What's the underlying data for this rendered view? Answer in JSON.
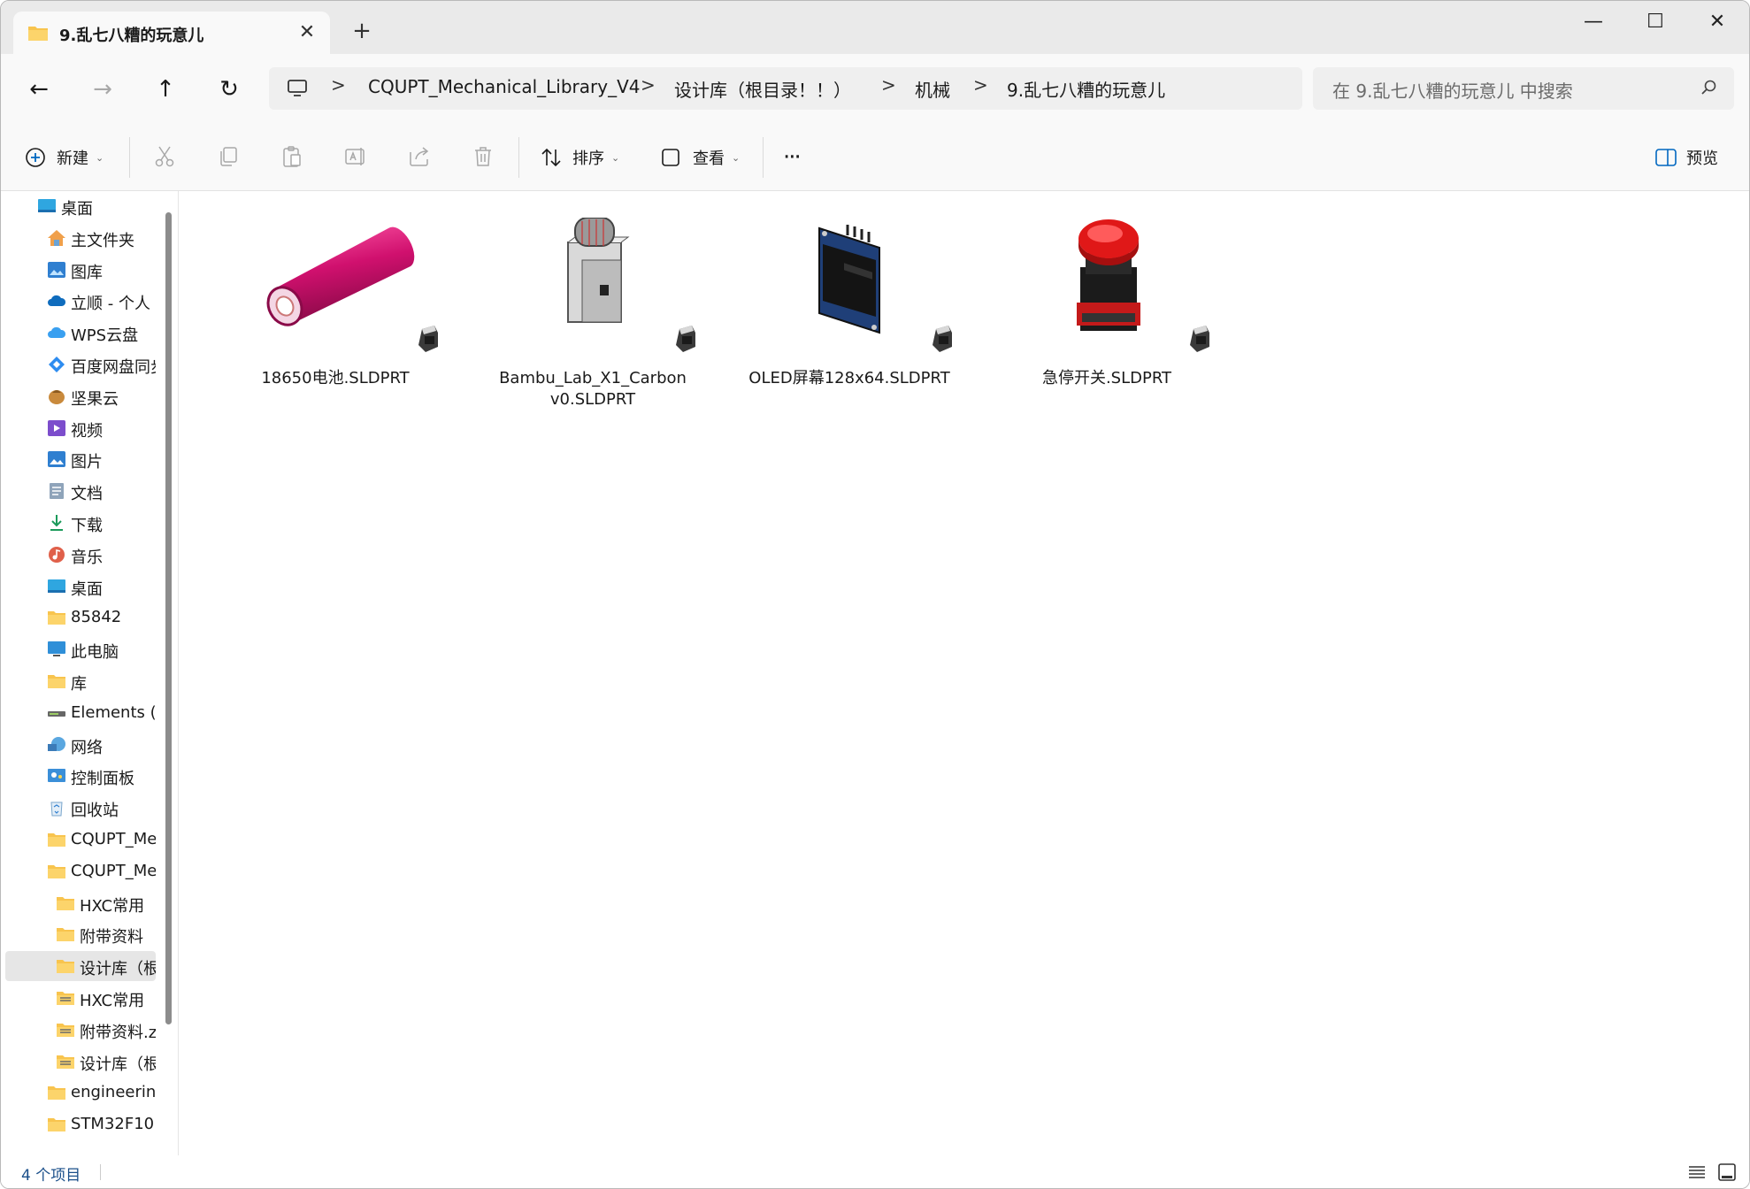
{
  "tab": {
    "title": "9.乱七八糟的玩意儿",
    "close_glyph": "✕",
    "new_tab_glyph": "+"
  },
  "window_controls": {
    "minimize": "—",
    "maximize": "☐",
    "close": "✕"
  },
  "nav": {
    "back": "←",
    "forward": "→",
    "up": "↑",
    "refresh": "↻"
  },
  "breadcrumb": {
    "items": [
      "CQUPT_Mechanical_Library_V4",
      "设计库（根目录！！）",
      "机械",
      "9.乱七八糟的玩意儿"
    ],
    "separator": ">"
  },
  "search": {
    "placeholder": "在 9.乱七八糟的玩意儿 中搜索"
  },
  "commandbar": {
    "new_label": "新建",
    "sort_label": "排序",
    "view_label": "查看",
    "more_label": "···",
    "preview_label": "预览"
  },
  "sidebar": {
    "items": [
      {
        "label": "桌面",
        "icon": "desktop-icon",
        "indent": 0
      },
      {
        "label": "主文件夹",
        "icon": "home-icon",
        "indent": 1
      },
      {
        "label": "图库",
        "icon": "gallery-icon",
        "indent": 1
      },
      {
        "label": "立顺 - 个人",
        "icon": "onedrive-icon",
        "indent": 1
      },
      {
        "label": "WPS云盘",
        "icon": "wps-cloud-icon",
        "indent": 1
      },
      {
        "label": "百度网盘同步",
        "icon": "baidu-netdisk-icon",
        "indent": 1
      },
      {
        "label": "坚果云",
        "icon": "jianguoyun-icon",
        "indent": 1
      },
      {
        "label": "视频",
        "icon": "video-icon",
        "indent": 1
      },
      {
        "label": "图片",
        "icon": "pictures-icon",
        "indent": 1
      },
      {
        "label": "文档",
        "icon": "documents-icon",
        "indent": 1
      },
      {
        "label": "下载",
        "icon": "download-icon",
        "indent": 1
      },
      {
        "label": "音乐",
        "icon": "music-icon",
        "indent": 1
      },
      {
        "label": "桌面",
        "icon": "desktop-icon",
        "indent": 1
      },
      {
        "label": "85842",
        "icon": "folder-icon",
        "indent": 1
      },
      {
        "label": "此电脑",
        "icon": "this-pc-icon",
        "indent": 1
      },
      {
        "label": "库",
        "icon": "folder-icon",
        "indent": 1
      },
      {
        "label": "Elements (I",
        "icon": "drive-icon",
        "indent": 1
      },
      {
        "label": "网络",
        "icon": "network-icon",
        "indent": 1
      },
      {
        "label": "控制面板",
        "icon": "control-panel-icon",
        "indent": 1
      },
      {
        "label": "回收站",
        "icon": "recycle-bin-icon",
        "indent": 1
      },
      {
        "label": "CQUPT_Me",
        "icon": "folder-icon",
        "indent": 1
      },
      {
        "label": "CQUPT_Me",
        "icon": "folder-icon",
        "indent": 1
      },
      {
        "label": "HXC常用",
        "icon": "folder-icon",
        "indent": 2
      },
      {
        "label": "附带资料",
        "icon": "folder-icon",
        "indent": 2
      },
      {
        "label": "设计库（根",
        "icon": "folder-icon",
        "indent": 2,
        "selected": true
      },
      {
        "label": "HXC常用",
        "icon": "zip-folder-icon",
        "indent": 2
      },
      {
        "label": "附带资料.z",
        "icon": "zip-folder-icon",
        "indent": 2
      },
      {
        "label": "设计库（根",
        "icon": "zip-folder-icon",
        "indent": 2
      },
      {
        "label": "engineering",
        "icon": "folder-icon",
        "indent": 1
      },
      {
        "label": "STM32F10",
        "icon": "folder-icon",
        "indent": 1
      }
    ]
  },
  "files": [
    {
      "name": "18650电池.SLDPRT",
      "thumb": "battery-18650-thumbnail"
    },
    {
      "name": "Bambu_Lab_X1_Carbon v0.SLDPRT",
      "thumb": "bambu-printer-thumbnail"
    },
    {
      "name": "OLED屏幕128x64.SLDPRT",
      "thumb": "oled-screen-thumbnail"
    },
    {
      "name": "急停开关.SLDPRT",
      "thumb": "emergency-stop-thumbnail"
    }
  ],
  "status": {
    "item_count": "4 个项目"
  },
  "colors": {
    "accent": "#0067c0",
    "folder": "#f8c44e",
    "selection": "#e6e6e6"
  }
}
